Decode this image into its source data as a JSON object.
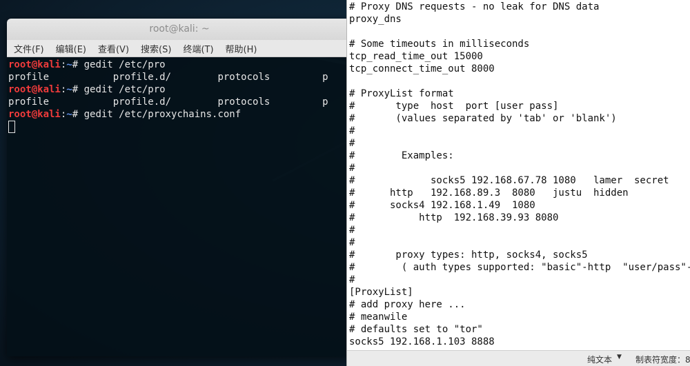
{
  "terminal": {
    "title": "root@kali: ~",
    "menu": [
      "文件(F)",
      "编辑(E)",
      "查看(V)",
      "搜索(S)",
      "终端(T)",
      "帮助(H)"
    ],
    "prompt": {
      "user_host": "root@kali",
      "colon": ":",
      "path": "~",
      "symbol": "# "
    },
    "lines": [
      {
        "type": "prompt",
        "command": "gedit /etc/pro"
      },
      {
        "type": "completion",
        "items": [
          "profile",
          "profile.d/",
          "protocols",
          "p"
        ]
      },
      {
        "type": "prompt",
        "command": "gedit /etc/pro"
      },
      {
        "type": "completion",
        "items": [
          "profile",
          "profile.d/",
          "protocols",
          "p"
        ]
      },
      {
        "type": "prompt",
        "command": "gedit /etc/proxychains.conf"
      }
    ]
  },
  "editor": {
    "lines": [
      "# Proxy DNS requests - no leak for DNS data",
      "proxy_dns",
      "",
      "# Some timeouts in milliseconds",
      "tcp_read_time_out 15000",
      "tcp_connect_time_out 8000",
      "",
      "# ProxyList format",
      "#       type  host  port [user pass]",
      "#       (values separated by 'tab' or 'blank')",
      "#",
      "#",
      "#        Examples:",
      "#",
      "#             socks5 192.168.67.78 1080   lamer  secret",
      "#      http   192.168.89.3  8080   justu  hidden",
      "#      socks4 192.168.1.49  1080",
      "#           http  192.168.39.93 8080",
      "#",
      "#",
      "#       proxy types: http, socks4, socks5",
      "#        ( auth types supported: \"basic\"-http  \"user/pass\"-socks )",
      "#",
      "[ProxyList]",
      "# add proxy here ...",
      "# meanwile",
      "# defaults set to \"tor\"",
      "socks5 192.168.1.103 8888"
    ],
    "status": {
      "language": "纯文本",
      "tab_width": "制表符宽度：8"
    }
  }
}
